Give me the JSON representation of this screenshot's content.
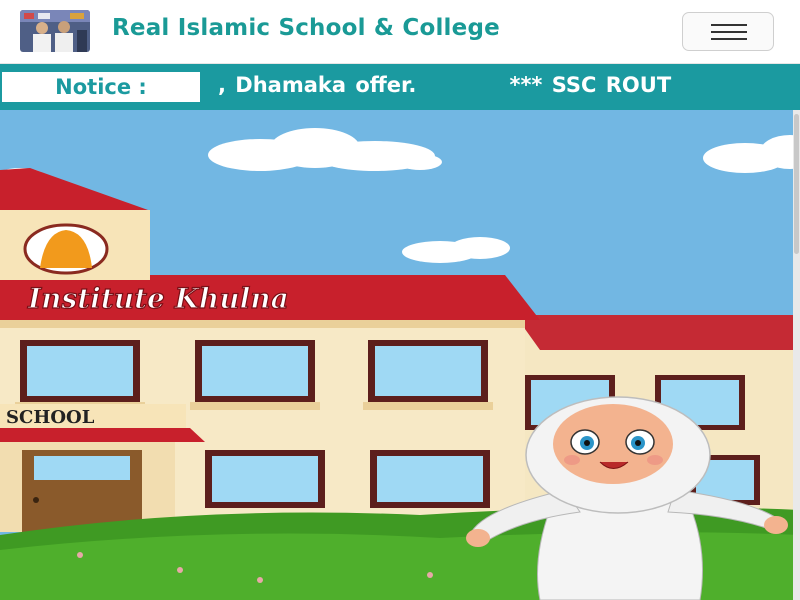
{
  "header": {
    "title": "Real Islamic School & College",
    "brand_color": "#1a9a96",
    "logo_icon": "school-photo-logo",
    "menu_icon": "hamburger-menu-icon"
  },
  "notice": {
    "label": "Notice :",
    "text": ", Dhamaka offer.          *** SSC ROUT",
    "bar_color": "#1b9aa0"
  },
  "hero": {
    "sign_text": "Institute Khulna",
    "school_text": "SCHOOL",
    "sky_color": "#72b7e3",
    "grass_color": "#3f9a23"
  }
}
